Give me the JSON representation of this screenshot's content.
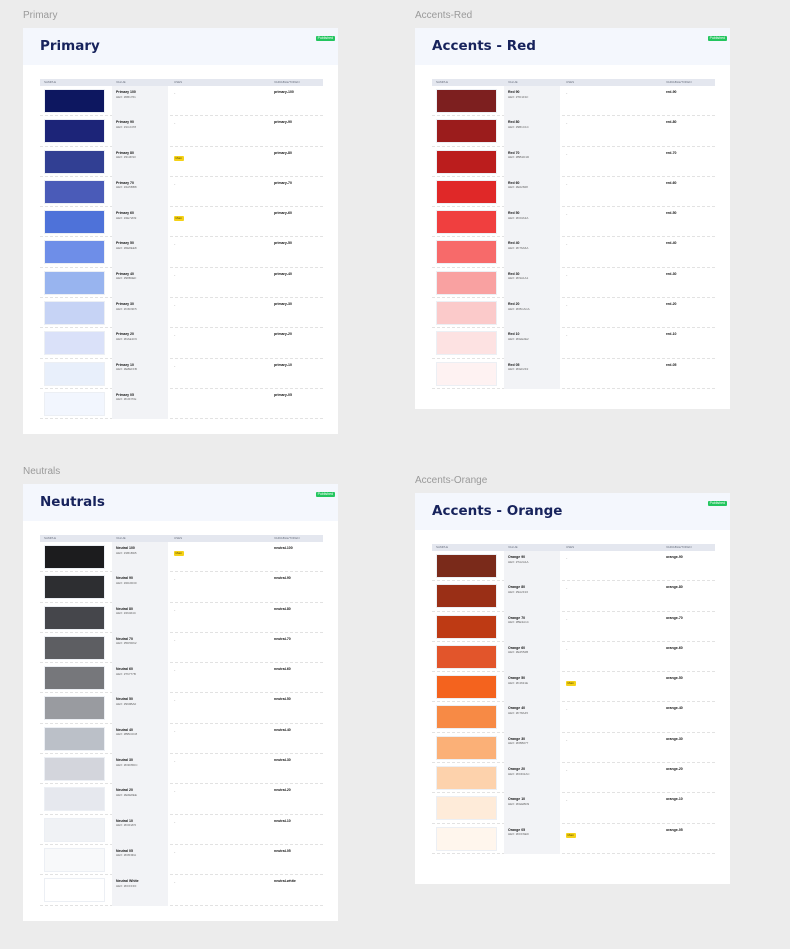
{
  "sections": [
    {
      "id": "primary",
      "frame_label": "Primary",
      "title": "Primary",
      "badge": "Published",
      "columns": [
        "SAMPLE",
        "VALUE",
        "USES",
        "VARIABLE/TOKEN"
      ],
      "rows": [
        {
          "name": "Primary 100",
          "hex": "HEX: #0B1761",
          "uses": "-",
          "tag": "",
          "token": "primary-100",
          "color": "#0d1760"
        },
        {
          "name": "Primary 90",
          "hex": "HEX: #1C2478",
          "uses": "-",
          "tag": "",
          "token": "primary-90",
          "color": "#1c2478"
        },
        {
          "name": "Primary 80",
          "hex": "HEX: #313F93",
          "uses": "",
          "tag": "Main",
          "token": "primary-80",
          "color": "#313f93"
        },
        {
          "name": "Primary 70",
          "hex": "HEX: #4A5BB8",
          "uses": "-",
          "tag": "",
          "token": "primary-70",
          "color": "#4a5bb8"
        },
        {
          "name": "Primary 60",
          "hex": "HEX: #4E72D9",
          "uses": "",
          "tag": "Main",
          "token": "primary-60",
          "color": "#4e72d9"
        },
        {
          "name": "Primary 50",
          "hex": "HEX: #6E8EE8",
          "uses": "-",
          "tag": "",
          "token": "primary-50",
          "color": "#6e8ee8"
        },
        {
          "name": "Primary 40",
          "hex": "HEX: #98B4EF",
          "uses": "-",
          "tag": "",
          "token": "primary-40",
          "color": "#98b4ef"
        },
        {
          "name": "Primary 30",
          "hex": "HEX: #C6D3F5",
          "uses": "-",
          "tag": "",
          "token": "primary-30",
          "color": "#c6d3f5"
        },
        {
          "name": "Primary 20",
          "hex": "HEX: #DAE1F9",
          "uses": "-",
          "tag": "",
          "token": "primary-20",
          "color": "#dae1f9"
        },
        {
          "name": "Primary 10",
          "hex": "HEX: #E8EFFB",
          "uses": "-",
          "tag": "",
          "token": "primary-10",
          "color": "#e8effb"
        },
        {
          "name": "Primary 05",
          "hex": "HEX: #F2F7FE",
          "uses": "",
          "tag": "",
          "token": "primary-05",
          "color": "#f2f6fe"
        }
      ]
    },
    {
      "id": "accents-red",
      "frame_label": "Accents-Red",
      "title": "Accents - Red",
      "badge": "Published",
      "columns": [
        "SAMPLE",
        "VALUE",
        "USES",
        "VARIABLE/TOKEN"
      ],
      "rows": [
        {
          "name": "Red 90",
          "hex": "HEX: #7D1F1F",
          "uses": "-",
          "tag": "",
          "token": "red-90",
          "color": "#7d1f1f"
        },
        {
          "name": "Red 80",
          "hex": "HEX: #9B1C1C",
          "uses": "-",
          "tag": "",
          "token": "red-80",
          "color": "#9b1c1c"
        },
        {
          "name": "Red 70",
          "hex": "HEX: #BB1D1D",
          "uses": "-",
          "tag": "",
          "token": "red-70",
          "color": "#bb1d1d"
        },
        {
          "name": "Red 60",
          "hex": "HEX: #E02828",
          "uses": "-",
          "tag": "",
          "token": "red-60",
          "color": "#e02828"
        },
        {
          "name": "Red 50",
          "hex": "HEX: #F03A3A",
          "uses": "-",
          "tag": "",
          "token": "red-50",
          "color": "#f03f3f"
        },
        {
          "name": "Red 40",
          "hex": "HEX: #F76A6A",
          "uses": "-",
          "tag": "",
          "token": "red-40",
          "color": "#f76a6a"
        },
        {
          "name": "Red 30",
          "hex": "HEX: #F9A1A1",
          "uses": "-",
          "tag": "",
          "token": "red-30",
          "color": "#f9a1a1"
        },
        {
          "name": "Red 20",
          "hex": "HEX: #FBCACA",
          "uses": "-",
          "tag": "",
          "token": "red-20",
          "color": "#fbcaca"
        },
        {
          "name": "Red 10",
          "hex": "HEX: #FEE2E2",
          "uses": "-",
          "tag": "",
          "token": "red-10",
          "color": "#fde2e2"
        },
        {
          "name": "Red 05",
          "hex": "HEX: #FEF2F2",
          "uses": "",
          "tag": "",
          "token": "red-05",
          "color": "#fef2f2"
        }
      ]
    },
    {
      "id": "neutrals",
      "frame_label": "Neutrals",
      "title": "Neutrals",
      "badge": "Published",
      "columns": [
        "SAMPLE",
        "VALUE",
        "USES",
        "VARIABLE/TOKEN"
      ],
      "rows": [
        {
          "name": "Neutral 100",
          "hex": "HEX: #1B1B1B",
          "uses": "",
          "tag": "Main",
          "token": "neutral-100",
          "color": "#1c1c1e"
        },
        {
          "name": "Neutral 90",
          "hex": "HEX: #2D2D30",
          "uses": "-",
          "tag": "",
          "token": "neutral-90",
          "color": "#2d2e31"
        },
        {
          "name": "Neutral 80",
          "hex": "HEX: #46464C",
          "uses": "-",
          "tag": "",
          "token": "neutral-80",
          "color": "#45464b"
        },
        {
          "name": "Neutral 70",
          "hex": "HEX: #5D5D62",
          "uses": "-",
          "tag": "",
          "token": "neutral-70",
          "color": "#5d5e62"
        },
        {
          "name": "Neutral 60",
          "hex": "HEX: #76777B",
          "uses": "-",
          "tag": "",
          "token": "neutral-60",
          "color": "#76777b"
        },
        {
          "name": "Neutral 50",
          "hex": "HEX: #999BA0",
          "uses": "-",
          "tag": "",
          "token": "neutral-50",
          "color": "#999ba0"
        },
        {
          "name": "Neutral 40",
          "hex": "HEX: #BBC0C8",
          "uses": "-",
          "tag": "",
          "token": "neutral-40",
          "color": "#bbc0c8"
        },
        {
          "name": "Neutral 30",
          "hex": "HEX: #D3D5DC",
          "uses": "-",
          "tag": "",
          "token": "neutral-30",
          "color": "#d3d5dc"
        },
        {
          "name": "Neutral 20",
          "hex": "HEX: #E6E8EE",
          "uses": "-",
          "tag": "",
          "token": "neutral-20",
          "color": "#e6e8ee"
        },
        {
          "name": "Neutral 10",
          "hex": "HEX: #F0F2F5",
          "uses": "-",
          "tag": "",
          "token": "neutral-10",
          "color": "#f0f2f5"
        },
        {
          "name": "Neutral 05",
          "hex": "HEX: #F8F9FA",
          "uses": "-",
          "tag": "",
          "token": "neutral-05",
          "color": "#f8f9fa"
        },
        {
          "name": "Neutral White",
          "hex": "HEX: #FFFFFF",
          "uses": "-",
          "tag": "",
          "token": "neutral-white",
          "color": "#ffffff"
        }
      ]
    },
    {
      "id": "accents-orange",
      "frame_label": "Accents-Orange",
      "title": "Accents - Orange",
      "badge": "Published",
      "columns": [
        "SAMPLE",
        "VALUE",
        "USES",
        "VARIABLE/TOKEN"
      ],
      "rows": [
        {
          "name": "Orange 90",
          "hex": "HEX: #7A2A1A",
          "uses": "-",
          "tag": "",
          "token": "orange-90",
          "color": "#7a2a1a"
        },
        {
          "name": "Orange 80",
          "hex": "HEX: #9A2F16",
          "uses": "-",
          "tag": "",
          "token": "orange-80",
          "color": "#9a2f16"
        },
        {
          "name": "Orange 70",
          "hex": "HEX: #BE3A14",
          "uses": "-",
          "tag": "",
          "token": "orange-70",
          "color": "#be3a14"
        },
        {
          "name": "Orange 60",
          "hex": "HEX: #E2552B",
          "uses": "-",
          "tag": "",
          "token": "orange-60",
          "color": "#e2552b"
        },
        {
          "name": "Orange 50",
          "hex": "HEX: #F4631E",
          "uses": "",
          "tag": "Main",
          "token": "orange-50",
          "color": "#f4631e"
        },
        {
          "name": "Orange 40",
          "hex": "HEX: #F78A45",
          "uses": "-",
          "tag": "",
          "token": "orange-40",
          "color": "#f78a45"
        },
        {
          "name": "Orange 30",
          "hex": "HEX: #FBB077",
          "uses": "-",
          "tag": "",
          "token": "orange-30",
          "color": "#fbb077"
        },
        {
          "name": "Orange 20",
          "hex": "HEX: #FDD2AC",
          "uses": "-",
          "tag": "",
          "token": "orange-20",
          "color": "#fdd2ac"
        },
        {
          "name": "Orange 10",
          "hex": "HEX: #FEEBD9",
          "uses": "-",
          "tag": "",
          "token": "orange-10",
          "color": "#feebd9"
        },
        {
          "name": "Orange 05",
          "hex": "HEX: #FFF6ED",
          "uses": "",
          "tag": "Main",
          "token": "orange-05",
          "color": "#fff6ed"
        }
      ]
    }
  ]
}
